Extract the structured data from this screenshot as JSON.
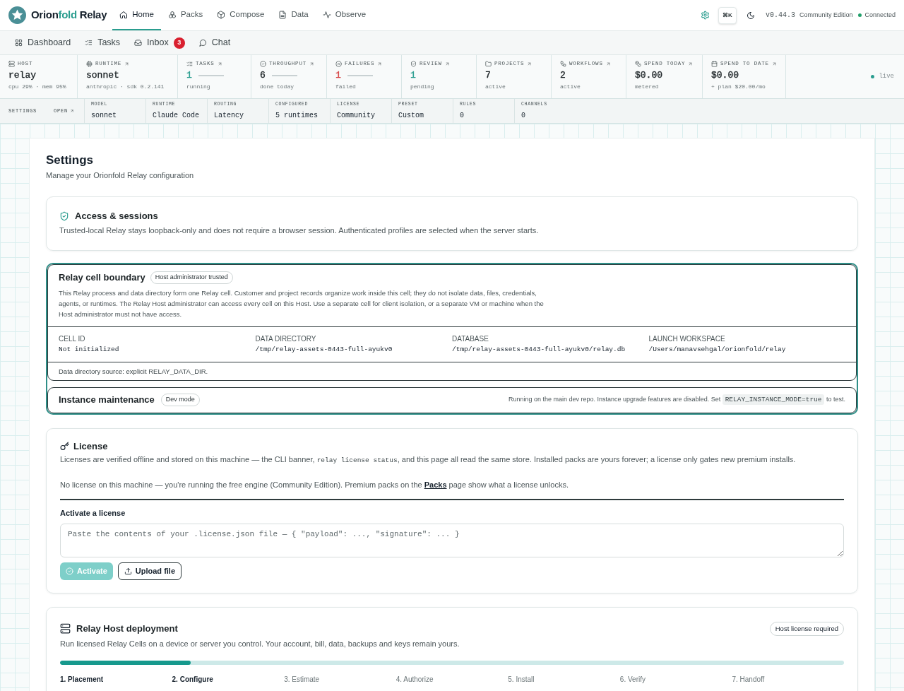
{
  "brand": {
    "parts": [
      {
        "text": "Orion",
        "accent": false
      },
      {
        "text": "fold",
        "accent": true
      },
      {
        "text": " Relay",
        "accent": false
      }
    ]
  },
  "nav": [
    {
      "label": "Home",
      "selected": true
    },
    {
      "label": "Packs",
      "selected": false
    },
    {
      "label": "Compose",
      "selected": false
    },
    {
      "label": "Data",
      "selected": false
    },
    {
      "label": "Observe",
      "selected": false
    }
  ],
  "header_tools": {
    "shortcut": "⌘K",
    "version": "v0.44.3",
    "edition": "Community Edition",
    "status": {
      "label": "Connected",
      "online": true
    }
  },
  "subnav": [
    {
      "label": "Dashboard",
      "selected": false
    },
    {
      "label": "Tasks",
      "selected": false
    },
    {
      "label": "Inbox",
      "badge": "3",
      "selected": false
    },
    {
      "label": "Chat",
      "selected": false
    }
  ],
  "stats": [
    {
      "label": "HOST",
      "link": false,
      "value": "relay",
      "color": "#1c2326",
      "kind": "plain",
      "sub": "cpu 29% · mem 95%"
    },
    {
      "label": "RUNTIME",
      "link": true,
      "value": "sonnet",
      "color": "#1c2326",
      "kind": "plain",
      "sub": "anthropic · sdk 0.2.141"
    },
    {
      "label": "TASKS",
      "link": true,
      "value": "1",
      "color": "#2a9d8f",
      "kind": "trend",
      "sub": "running"
    },
    {
      "label": "THROUGHPUT",
      "link": true,
      "value": "6",
      "color": "#1c2326",
      "kind": "trend",
      "sub": "done today"
    },
    {
      "label": "FAILURES",
      "link": true,
      "value": "1",
      "color": "#d64545",
      "kind": "trend",
      "sub": "failed"
    },
    {
      "label": "REVIEW",
      "link": true,
      "value": "1",
      "color": "#2a9d8f",
      "kind": "plain",
      "sub": "pending"
    },
    {
      "label": "PROJECTS",
      "link": true,
      "value": "7",
      "color": "#1c2326",
      "kind": "plain",
      "sub": "active"
    },
    {
      "label": "WORKFLOWS",
      "link": true,
      "value": "2",
      "color": "#1c2326",
      "kind": "plain",
      "sub": "active"
    },
    {
      "label": "SPEND TODAY",
      "link": true,
      "value": "$0.00",
      "color": "#1c2326",
      "kind": "plain",
      "sub": "metered"
    },
    {
      "label": "SPEND TO DATE",
      "link": true,
      "value": "$0.00",
      "color": "#1c2326",
      "kind": "plain",
      "sub": "+ plan $20.00/mo"
    }
  ],
  "live": {
    "label": "live",
    "on": true
  },
  "config": {
    "title": "SETTINGS",
    "open": "OPEN",
    "fields": [
      {
        "label": "MODEL",
        "value": "sonnet"
      },
      {
        "label": "RUNTIME",
        "value": "Claude Code"
      },
      {
        "label": "ROUTING",
        "value": "Latency"
      },
      {
        "label": "CONFIGURED",
        "value": "5 runtimes"
      },
      {
        "label": "LICENSE",
        "value": "Community"
      },
      {
        "label": "PRESET",
        "value": "Custom"
      },
      {
        "label": "RULES",
        "value": "0"
      },
      {
        "label": "CHANNELS",
        "value": "0"
      }
    ]
  },
  "page": {
    "title": "Settings",
    "subtitle": "Manage your Orionfold Relay configuration"
  },
  "access": {
    "title": "Access & sessions",
    "description": "Trusted-local Relay stays loopback-only and does not require a browser session. Authenticated profiles are selected when the server starts."
  },
  "cell_boundary": {
    "title": "Relay cell boundary",
    "badge": "Host administrator trusted",
    "description": "This Relay process and data directory form one Relay cell. Customer and project records organize work inside this cell; they do not isolate data, files, credentials, agents, or runtimes. The Relay Host administrator can access every cell on this Host. Use a separate cell for client isolation, or a separate VM or machine when the Host administrator must not have access.",
    "fields": [
      {
        "label": "CELL ID",
        "value": "Not initialized"
      },
      {
        "label": "DATA DIRECTORY",
        "value": "/tmp/relay-assets-0443-full-ayukv0"
      },
      {
        "label": "DATABASE",
        "value": "/tmp/relay-assets-0443-full-ayukv0/relay.db"
      },
      {
        "label": "LAUNCH WORKSPACE",
        "value": "/Users/manavsehgal/orionfold/relay"
      }
    ],
    "source": "Data directory source: explicit RELAY_DATA_DIR."
  },
  "maintenance": {
    "title": "Instance maintenance",
    "badge": "Dev mode",
    "note": [
      {
        "kind": "text",
        "text": "Running on the main dev repo. Instance upgrade features are disabled. Set "
      },
      {
        "kind": "code",
        "text": "RELAY_INSTANCE_MODE=true"
      },
      {
        "kind": "text",
        "text": " to test."
      }
    ]
  },
  "license": {
    "title": "License",
    "paragraphs": [
      [
        {
          "kind": "text",
          "text": "Licenses are verified offline and stored on this machine — the CLI banner, "
        },
        {
          "kind": "code",
          "text": "relay license status"
        },
        {
          "kind": "text",
          "text": ", and this page all read the same store. Installed packs are yours forever; a license only gates new premium installs."
        }
      ],
      [
        {
          "kind": "text",
          "text": "No license on this machine — you're running the free engine (Community Edition). Premium packs on the "
        },
        {
          "kind": "link",
          "text": "Packs"
        },
        {
          "kind": "text",
          "text": " page show what a license unlocks."
        }
      ]
    ],
    "activate_label": "Activate a license",
    "input": {
      "placeholder": "Paste the contents of your .license.json file — { \"payload\": ..., \"signature\": ... }"
    },
    "buttons": [
      {
        "label": "Activate",
        "kind": "primary",
        "disabled": true
      },
      {
        "label": "Upload file",
        "kind": "secondary",
        "disabled": false
      }
    ]
  },
  "deployment": {
    "title": "Relay Host deployment",
    "badge": "Host license required",
    "description": "Run licensed Relay Cells on a device or server you control. Your account, bill, data, backups and keys remain yours.",
    "progress": {
      "level": 0.167
    },
    "steps": [
      {
        "label": "1. Placement",
        "reached": true
      },
      {
        "label": "2. Configure",
        "reached": true
      },
      {
        "label": "3. Estimate",
        "reached": false
      },
      {
        "label": "4. Authorize",
        "reached": false
      },
      {
        "label": "5. Install",
        "reached": false
      },
      {
        "label": "6. Verify",
        "reached": false
      },
      {
        "label": "7. Handoff",
        "reached": false
      }
    ]
  }
}
